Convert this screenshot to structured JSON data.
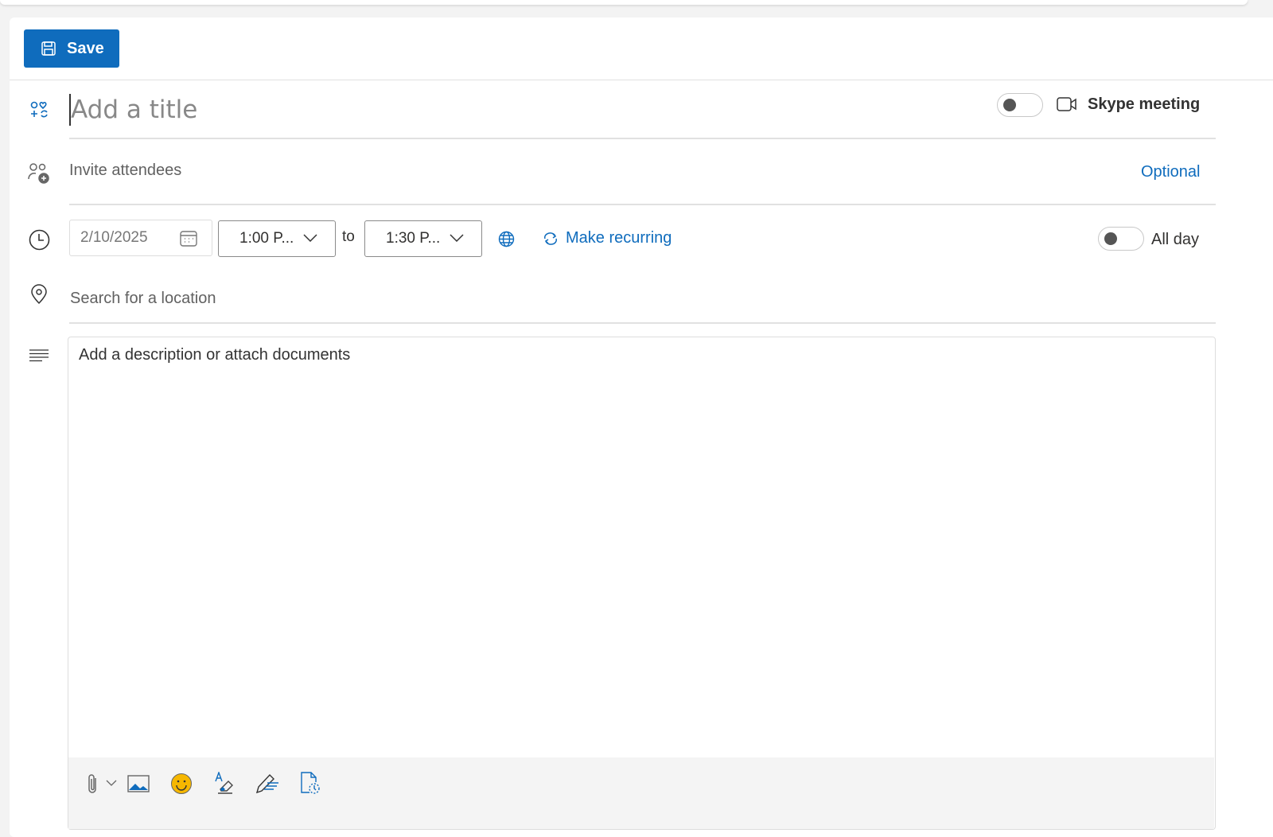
{
  "toolbar": {
    "save_label": "Save"
  },
  "form": {
    "title_placeholder": "Add a title",
    "skype_label": "Skype meeting",
    "attendees_placeholder": "Invite attendees",
    "optional_label": "Optional",
    "date": "2/10/2025",
    "start_time": "1:00 P...",
    "to_label": "to",
    "end_time": "1:30 P...",
    "make_recurring": "Make recurring",
    "all_day": "All day",
    "location_placeholder": "Search for a location",
    "description_placeholder": "Add a description or attach documents"
  },
  "colors": {
    "accent": "#0f6cbd"
  }
}
